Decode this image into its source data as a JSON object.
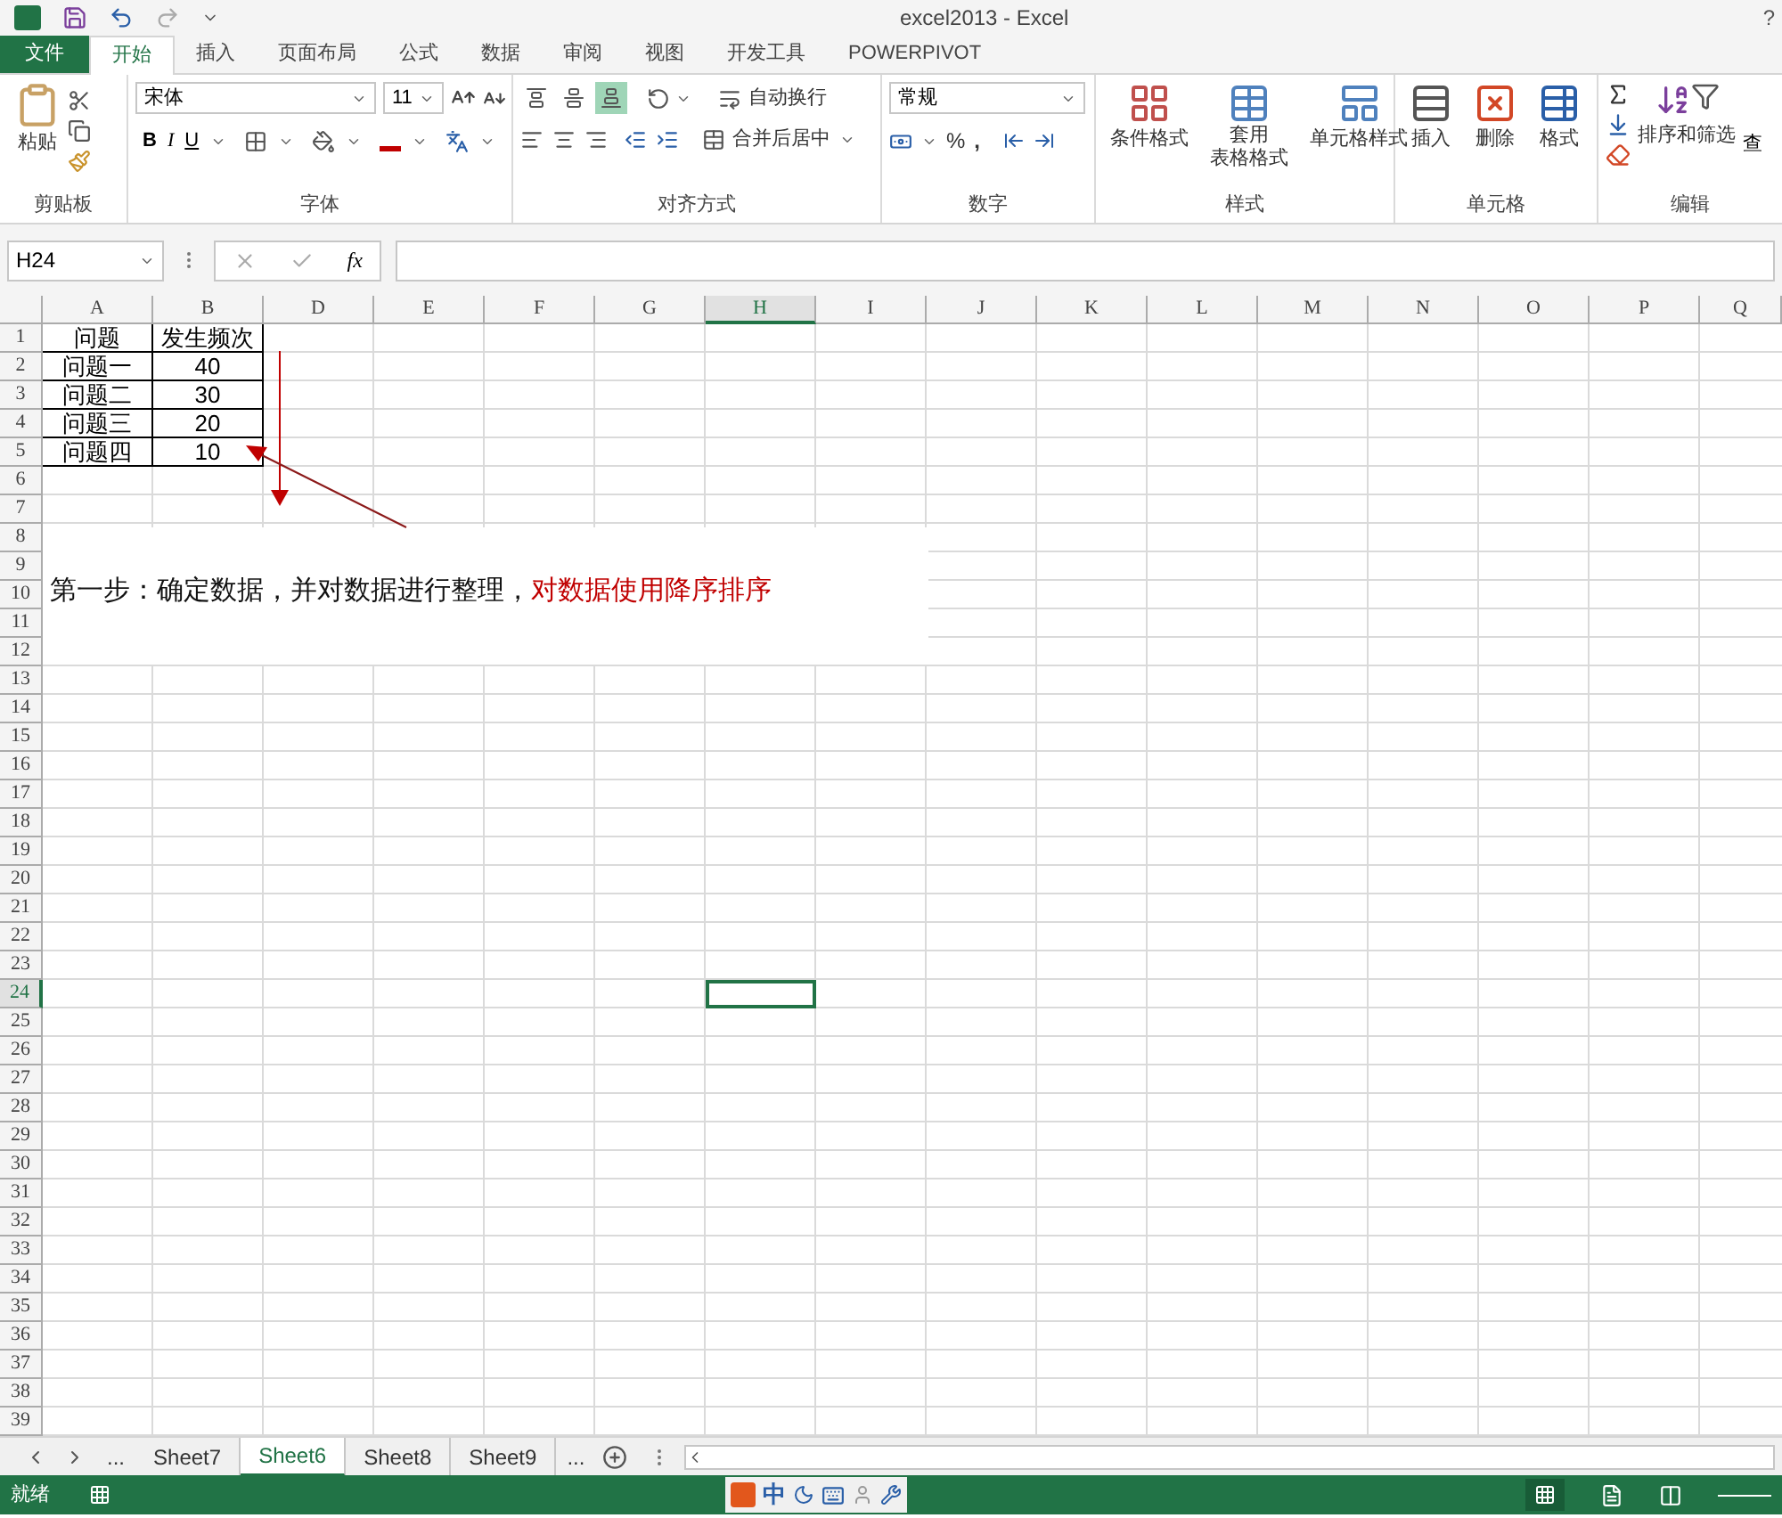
{
  "window": {
    "title": "excel2013 - Excel",
    "help": "?"
  },
  "ribbon_tabs": [
    {
      "label": "文件",
      "kind": "file",
      "selected": false
    },
    {
      "label": "开始",
      "kind": "tab",
      "selected": true
    },
    {
      "label": "插入",
      "kind": "tab",
      "selected": false
    },
    {
      "label": "页面布局",
      "kind": "tab",
      "selected": false
    },
    {
      "label": "公式",
      "kind": "tab",
      "selected": false
    },
    {
      "label": "数据",
      "kind": "tab",
      "selected": false
    },
    {
      "label": "审阅",
      "kind": "tab",
      "selected": false
    },
    {
      "label": "视图",
      "kind": "tab",
      "selected": false
    },
    {
      "label": "开发工具",
      "kind": "tab",
      "selected": false
    },
    {
      "label": "POWERPIVOT",
      "kind": "tab",
      "selected": false
    }
  ],
  "ribbon": {
    "clipboard": {
      "paste": "粘贴",
      "label": "剪贴板"
    },
    "font": {
      "font_name": "宋体",
      "font_size": "11",
      "bold": "B",
      "italic": "I",
      "underline": "U",
      "label": "字体"
    },
    "alignment": {
      "vertical": [
        {
          "kind": "top",
          "selected": false
        },
        {
          "kind": "middle",
          "selected": false
        },
        {
          "kind": "bottom",
          "selected": true
        }
      ],
      "wrap": "自动换行",
      "merge": "合并后居中",
      "label": "对齐方式"
    },
    "number": {
      "format": "常规",
      "percent": "%",
      "comma": ",",
      "label": "数字"
    },
    "styles": {
      "conditional": "条件格式",
      "table_format": [
        "套用",
        "表格格式"
      ],
      "cell_styles": "单元格样式",
      "label": "样式"
    },
    "cells": {
      "insert": "插入",
      "delete": "删除",
      "format": "格式",
      "label": "单元格"
    },
    "editing": {
      "sort_filter": "排序和筛选",
      "find": "查",
      "label": "编辑"
    }
  },
  "formula_bar": {
    "name_box": "H24",
    "function_label": "fx"
  },
  "columns": [
    {
      "label": "A",
      "selected": false
    },
    {
      "label": "B",
      "selected": false
    },
    {
      "label": "D",
      "selected": false
    },
    {
      "label": "E",
      "selected": false
    },
    {
      "label": "F",
      "selected": false
    },
    {
      "label": "G",
      "selected": false
    },
    {
      "label": "H",
      "selected": true
    },
    {
      "label": "I",
      "selected": false
    },
    {
      "label": "J",
      "selected": false
    },
    {
      "label": "K",
      "selected": false
    },
    {
      "label": "L",
      "selected": false
    },
    {
      "label": "M",
      "selected": false
    },
    {
      "label": "N",
      "selected": false
    },
    {
      "label": "O",
      "selected": false
    },
    {
      "label": "P",
      "selected": false
    },
    {
      "label": "Q",
      "selected": false
    }
  ],
  "rows": [
    {
      "label": "1",
      "selected": false
    },
    {
      "label": "2",
      "selected": false
    },
    {
      "label": "3",
      "selected": false
    },
    {
      "label": "4",
      "selected": false
    },
    {
      "label": "5",
      "selected": false
    },
    {
      "label": "6",
      "selected": false
    },
    {
      "label": "7",
      "selected": false
    },
    {
      "label": "8",
      "selected": false
    },
    {
      "label": "9",
      "selected": false
    },
    {
      "label": "10",
      "selected": false
    },
    {
      "label": "11",
      "selected": false
    },
    {
      "label": "12",
      "selected": false
    },
    {
      "label": "13",
      "selected": false
    },
    {
      "label": "14",
      "selected": false
    },
    {
      "label": "15",
      "selected": false
    },
    {
      "label": "16",
      "selected": false
    },
    {
      "label": "17",
      "selected": false
    },
    {
      "label": "18",
      "selected": false
    },
    {
      "label": "19",
      "selected": false
    },
    {
      "label": "20",
      "selected": false
    },
    {
      "label": "21",
      "selected": false
    },
    {
      "label": "22",
      "selected": false
    },
    {
      "label": "23",
      "selected": false
    },
    {
      "label": "24",
      "selected": true
    },
    {
      "label": "25",
      "selected": false
    },
    {
      "label": "26",
      "selected": false
    },
    {
      "label": "27",
      "selected": false
    },
    {
      "label": "28",
      "selected": false
    },
    {
      "label": "29",
      "selected": false
    },
    {
      "label": "30",
      "selected": false
    },
    {
      "label": "31",
      "selected": false
    },
    {
      "label": "32",
      "selected": false
    },
    {
      "label": "33",
      "selected": false
    },
    {
      "label": "34",
      "selected": false
    },
    {
      "label": "35",
      "selected": false
    },
    {
      "label": "36",
      "selected": false
    },
    {
      "label": "37",
      "selected": false
    },
    {
      "label": "38",
      "selected": false
    },
    {
      "label": "39",
      "selected": false
    }
  ],
  "table": [
    [
      "问题",
      "发生频次"
    ],
    [
      "问题一",
      "40"
    ],
    [
      "问题二",
      "30"
    ],
    [
      "问题三",
      "20"
    ],
    [
      "问题四",
      "10"
    ]
  ],
  "note": {
    "text": "第一步：确定数据，并对数据进行整理，",
    "highlight": "对数据使用降序排序"
  },
  "sheet_tabs": [
    {
      "label": "...",
      "kind": "more",
      "selected": false
    },
    {
      "label": "Sheet7",
      "kind": "sheet",
      "selected": false
    },
    {
      "label": "Sheet6",
      "kind": "sheet",
      "selected": true
    },
    {
      "label": "Sheet8",
      "kind": "sheet",
      "selected": false
    },
    {
      "label": "Sheet9",
      "kind": "sheet",
      "selected": false
    },
    {
      "label": "...",
      "kind": "more",
      "selected": false
    }
  ],
  "status_bar": {
    "status": "就绪",
    "ime": "中"
  }
}
